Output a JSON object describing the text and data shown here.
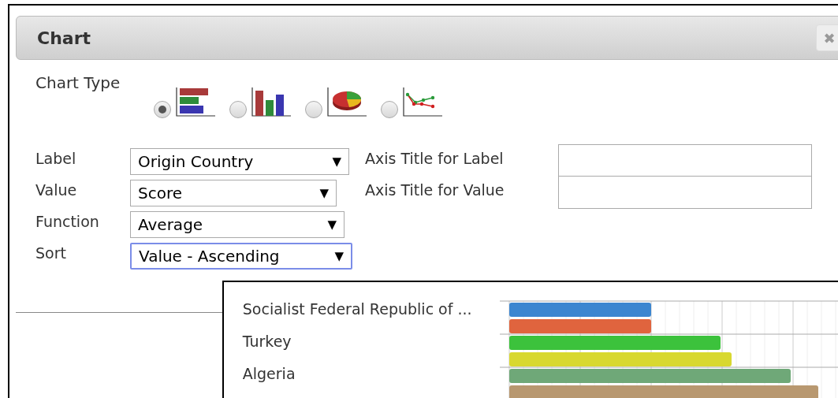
{
  "dialog": {
    "title": "Chart",
    "close": "✖"
  },
  "chart_type": {
    "label": "Chart Type",
    "options": [
      {
        "kind": "bar",
        "selected": true
      },
      {
        "kind": "column",
        "selected": false
      },
      {
        "kind": "pie",
        "selected": false
      },
      {
        "kind": "line",
        "selected": false
      }
    ]
  },
  "fields": [
    {
      "label": "Label",
      "value": "Origin Country",
      "focused": false,
      "axis_title": "Axis Title for Label"
    },
    {
      "label": "Value",
      "value": "Score",
      "focused": false,
      "axis_title": "Axis Title for Value"
    },
    {
      "label": "Function",
      "value": "Average",
      "focused": false
    },
    {
      "label": "Sort",
      "value": "Value - Ascending",
      "focused": true
    }
  ],
  "dropdown_arrow": "▼",
  "preview": {
    "categories": [
      "Socialist Federal Republic of ...",
      "Turkey",
      "Algeria"
    ]
  }
}
